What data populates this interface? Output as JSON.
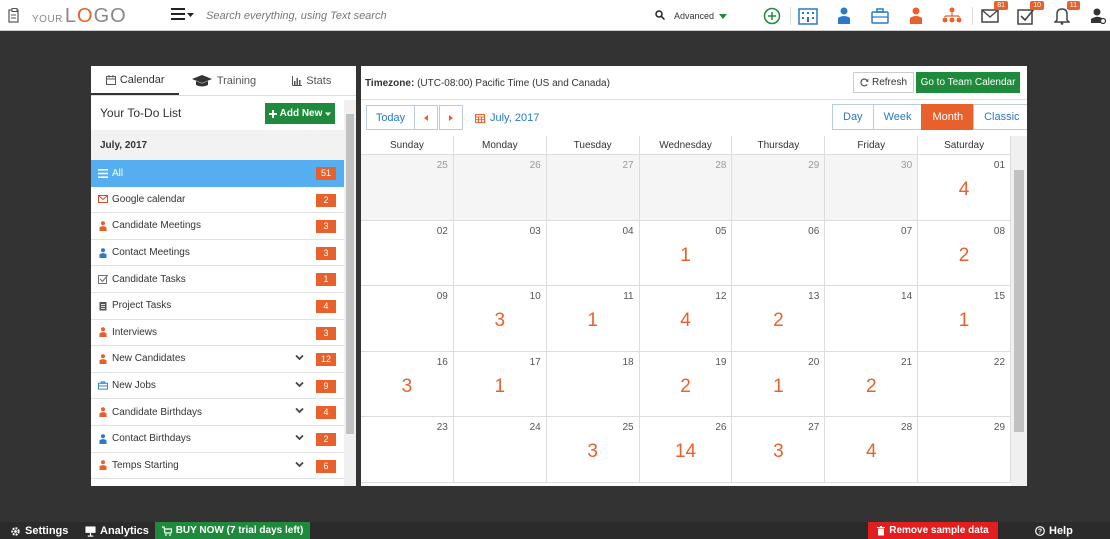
{
  "header": {
    "logo_your": "YOUR",
    "logo_l": "L",
    "logo_o": "O",
    "logo_go": "GO",
    "search_placeholder": "Search everything, using Text search",
    "advanced_label": "Advanced",
    "badges": {
      "mail": "81",
      "tasks": "10",
      "notifications": "11"
    }
  },
  "sidebar": {
    "tabs": [
      {
        "label": "Calendar",
        "icon": "calendar-icon",
        "active": true
      },
      {
        "label": "Training",
        "icon": "graduation-cap-icon",
        "active": false
      },
      {
        "label": "Stats",
        "icon": "bar-chart-icon",
        "active": false
      }
    ],
    "title": "Your To-Do List",
    "add_new_label": "Add New",
    "month": "July, 2017",
    "items": [
      {
        "label": "All",
        "count": "51",
        "icon": "list-icon",
        "active": true,
        "expandable": false,
        "color": "#ffffff"
      },
      {
        "label": "Google calendar",
        "count": "2",
        "icon": "gmail-icon",
        "active": false,
        "expandable": false,
        "color": "#d64a2e"
      },
      {
        "label": "Candidate Meetings",
        "count": "3",
        "icon": "person-icon",
        "active": false,
        "expandable": false,
        "color": "#e8612c"
      },
      {
        "label": "Contact Meetings",
        "count": "3",
        "icon": "person-icon",
        "active": false,
        "expandable": false,
        "color": "#2a7ac5"
      },
      {
        "label": "Candidate Tasks",
        "count": "1",
        "icon": "checkbox-icon",
        "active": false,
        "expandable": false,
        "color": "#777777"
      },
      {
        "label": "Project Tasks",
        "count": "4",
        "icon": "clipboard-icon",
        "active": false,
        "expandable": false,
        "color": "#555555"
      },
      {
        "label": "Interviews",
        "count": "3",
        "icon": "person-icon",
        "active": false,
        "expandable": false,
        "color": "#e8612c"
      },
      {
        "label": "New Candidates",
        "count": "12",
        "icon": "person-icon",
        "active": false,
        "expandable": true,
        "color": "#e8612c"
      },
      {
        "label": "New Jobs",
        "count": "9",
        "icon": "briefcase-icon",
        "active": false,
        "expandable": true,
        "color": "#2a7ac5"
      },
      {
        "label": "Candidate Birthdays",
        "count": "4",
        "icon": "person-icon",
        "active": false,
        "expandable": true,
        "color": "#e8612c"
      },
      {
        "label": "Contact Birthdays",
        "count": "2",
        "icon": "person-icon",
        "active": false,
        "expandable": true,
        "color": "#2a7ac5"
      },
      {
        "label": "Temps Starting",
        "count": "6",
        "icon": "person-icon",
        "active": false,
        "expandable": true,
        "color": "#e8612c"
      }
    ]
  },
  "calendar": {
    "timezone_label": "Timezone:",
    "timezone_value": "(UTC-08:00) Pacific Time (US and Canada)",
    "refresh_label": "Refresh",
    "team_label": "Go to Team Calendar",
    "today_label": "Today",
    "current_month": "July, 2017",
    "views": [
      {
        "label": "Day",
        "active": false
      },
      {
        "label": "Week",
        "active": false
      },
      {
        "label": "Month",
        "active": true
      },
      {
        "label": "Classic",
        "active": false
      }
    ],
    "weekdays": [
      "Sunday",
      "Monday",
      "Tuesday",
      "Wednesday",
      "Thursday",
      "Friday",
      "Saturday"
    ],
    "weeks": [
      [
        {
          "d": "25",
          "c": "",
          "o": true
        },
        {
          "d": "26",
          "c": "",
          "o": true
        },
        {
          "d": "27",
          "c": "",
          "o": true
        },
        {
          "d": "28",
          "c": "",
          "o": true
        },
        {
          "d": "29",
          "c": "",
          "o": true
        },
        {
          "d": "30",
          "c": "",
          "o": true
        },
        {
          "d": "01",
          "c": "4",
          "o": false
        }
      ],
      [
        {
          "d": "02",
          "c": "",
          "o": false
        },
        {
          "d": "03",
          "c": "",
          "o": false
        },
        {
          "d": "04",
          "c": "",
          "o": false
        },
        {
          "d": "05",
          "c": "1",
          "o": false
        },
        {
          "d": "06",
          "c": "",
          "o": false
        },
        {
          "d": "07",
          "c": "",
          "o": false
        },
        {
          "d": "08",
          "c": "2",
          "o": false
        }
      ],
      [
        {
          "d": "09",
          "c": "",
          "o": false
        },
        {
          "d": "10",
          "c": "3",
          "o": false
        },
        {
          "d": "11",
          "c": "1",
          "o": false
        },
        {
          "d": "12",
          "c": "4",
          "o": false
        },
        {
          "d": "13",
          "c": "2",
          "o": false
        },
        {
          "d": "14",
          "c": "",
          "o": false
        },
        {
          "d": "15",
          "c": "1",
          "o": false
        }
      ],
      [
        {
          "d": "16",
          "c": "3",
          "o": false
        },
        {
          "d": "17",
          "c": "1",
          "o": false
        },
        {
          "d": "18",
          "c": "",
          "o": false
        },
        {
          "d": "19",
          "c": "2",
          "o": false
        },
        {
          "d": "20",
          "c": "1",
          "o": false
        },
        {
          "d": "21",
          "c": "2",
          "o": false
        },
        {
          "d": "22",
          "c": "",
          "o": false
        }
      ],
      [
        {
          "d": "23",
          "c": "",
          "o": false
        },
        {
          "d": "24",
          "c": "",
          "o": false
        },
        {
          "d": "25",
          "c": "3",
          "o": false
        },
        {
          "d": "26",
          "c": "14",
          "o": false
        },
        {
          "d": "27",
          "c": "3",
          "o": false
        },
        {
          "d": "28",
          "c": "4",
          "o": false
        },
        {
          "d": "29",
          "c": "",
          "o": false
        }
      ]
    ]
  },
  "footer": {
    "settings_label": "Settings",
    "analytics_label": "Analytics",
    "buy_now_label": "BUY NOW (7 trial days left)",
    "remove_label": "Remove sample data",
    "help_label": "Help"
  },
  "colors": {
    "accent": "#e8612c",
    "green": "#1f8a3b",
    "blue": "#2a7ac5",
    "active_row": "#55aef0",
    "danger": "#e21e1e"
  }
}
